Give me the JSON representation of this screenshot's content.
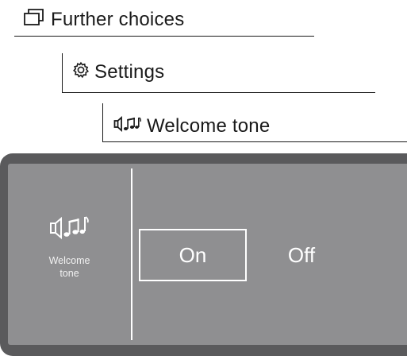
{
  "breadcrumb": {
    "level1": {
      "icon": "window-icon",
      "label": "Further choices"
    },
    "level2": {
      "icon": "gear-icon",
      "label": "Settings"
    },
    "level3": {
      "icon": "speaker-music-icon",
      "label": "Welcome tone"
    }
  },
  "panel": {
    "side": {
      "icon": "speaker-music-icon",
      "label_line1": "Welcome",
      "label_line2": "tone"
    },
    "options": [
      {
        "label": "On",
        "selected": true
      },
      {
        "label": "Off",
        "selected": false
      }
    ],
    "colors": {
      "frame": "#5a5a5c",
      "screen": "#8f8f91",
      "text": "#ffffff"
    }
  }
}
